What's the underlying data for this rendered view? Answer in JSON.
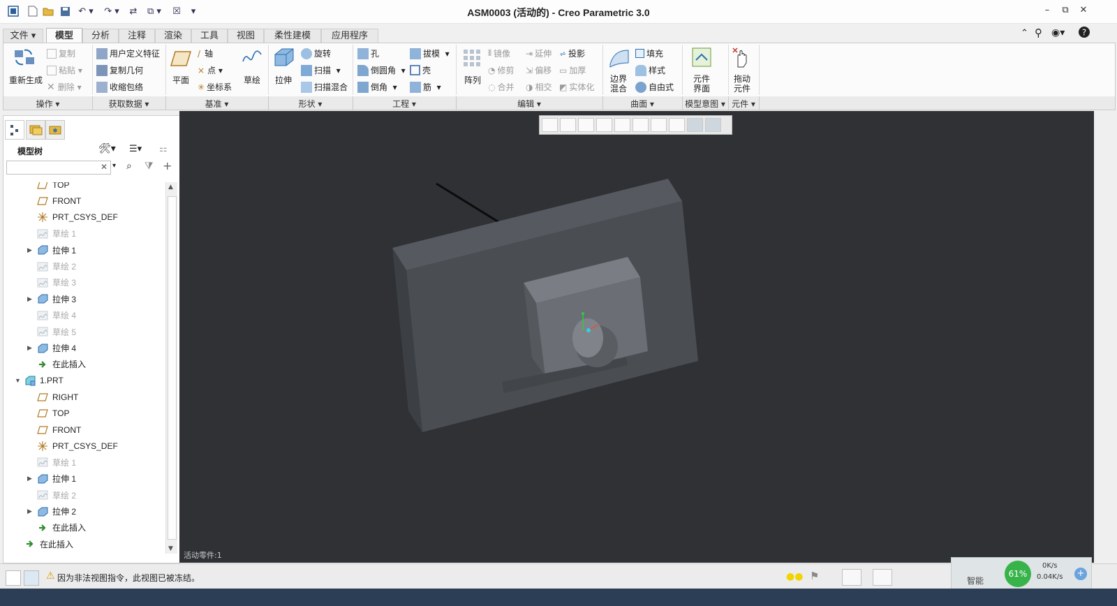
{
  "window": {
    "title": "ASM0003 (活动的) - Creo Parametric 3.0"
  },
  "tabs": [
    "文件",
    "模型",
    "分析",
    "注释",
    "渲染",
    "工具",
    "视图",
    "柔性建模",
    "应用程序"
  ],
  "ribbon": {
    "regenerate": "重新生成",
    "copy": "复制",
    "paste": "粘贴",
    "delete": "删除",
    "user_feature": "用户定义特征",
    "copy_geom": "复制几何",
    "shrinkwrap": "收缩包络",
    "plane": "平面",
    "axis": "轴",
    "point": "点",
    "csys": "坐标系",
    "sketch": "草绘",
    "extrude": "拉伸",
    "revolve": "旋转",
    "sweep": "扫描",
    "swept_blend": "扫描混合",
    "hole": "孔",
    "round": "倒圆角",
    "chamfer": "倒角",
    "draft": "拔模",
    "shell": "壳",
    "rib": "筋",
    "pattern": "阵列",
    "mirror": "镜像",
    "trim": "修剪",
    "merge": "合并",
    "extend": "延伸",
    "offset": "偏移",
    "intersect": "相交",
    "project": "投影",
    "thicken": "加厚",
    "solidify": "实体化",
    "boundary_blend_1": "边界",
    "boundary_blend_2": "混合",
    "fill": "填充",
    "style": "样式",
    "freestyle": "自由式",
    "comp_iface_1": "元件",
    "comp_iface_2": "界面",
    "drag_1": "拖动",
    "drag_2": "元件"
  },
  "groups": [
    "操作",
    "获取数据",
    "基准",
    "形状",
    "工程",
    "编辑",
    "曲面",
    "模型意图",
    "元件"
  ],
  "panel": {
    "title": "模型树"
  },
  "tree": [
    {
      "label": "TOP",
      "indent": 2,
      "icon": "plane",
      "dim": false,
      "expander": ""
    },
    {
      "label": "FRONT",
      "indent": 2,
      "icon": "plane",
      "dim": false,
      "expander": ""
    },
    {
      "label": "PRT_CSYS_DEF",
      "indent": 2,
      "icon": "csys",
      "dim": false,
      "expander": ""
    },
    {
      "label": "草绘 1",
      "indent": 2,
      "icon": "sketch",
      "dim": true,
      "expander": ""
    },
    {
      "label": "拉伸 1",
      "indent": 2,
      "icon": "extrude",
      "dim": false,
      "expander": "▶"
    },
    {
      "label": "草绘 2",
      "indent": 2,
      "icon": "sketch",
      "dim": true,
      "expander": ""
    },
    {
      "label": "草绘 3",
      "indent": 2,
      "icon": "sketch",
      "dim": true,
      "expander": ""
    },
    {
      "label": "拉伸 3",
      "indent": 2,
      "icon": "extrude",
      "dim": false,
      "expander": "▶"
    },
    {
      "label": "草绘 4",
      "indent": 2,
      "icon": "sketch",
      "dim": true,
      "expander": ""
    },
    {
      "label": "草绘 5",
      "indent": 2,
      "icon": "sketch",
      "dim": true,
      "expander": ""
    },
    {
      "label": "拉伸 4",
      "indent": 2,
      "icon": "extrude",
      "dim": false,
      "expander": "▶"
    },
    {
      "label": "在此插入",
      "indent": 2,
      "icon": "insert",
      "dim": false,
      "expander": ""
    },
    {
      "label": "1.PRT",
      "indent": 1,
      "icon": "part",
      "dim": false,
      "expander": "▼"
    },
    {
      "label": "RIGHT",
      "indent": 2,
      "icon": "plane",
      "dim": false,
      "expander": ""
    },
    {
      "label": "TOP",
      "indent": 2,
      "icon": "plane",
      "dim": false,
      "expander": ""
    },
    {
      "label": "FRONT",
      "indent": 2,
      "icon": "plane",
      "dim": false,
      "expander": ""
    },
    {
      "label": "PRT_CSYS_DEF",
      "indent": 2,
      "icon": "csys",
      "dim": false,
      "expander": ""
    },
    {
      "label": "草绘 1",
      "indent": 2,
      "icon": "sketch",
      "dim": true,
      "expander": ""
    },
    {
      "label": "拉伸 1",
      "indent": 2,
      "icon": "extrude",
      "dim": false,
      "expander": "▶"
    },
    {
      "label": "草绘 2",
      "indent": 2,
      "icon": "sketch",
      "dim": true,
      "expander": ""
    },
    {
      "label": "拉伸 2",
      "indent": 2,
      "icon": "extrude",
      "dim": false,
      "expander": "▶"
    },
    {
      "label": "在此插入",
      "indent": 2,
      "icon": "insert",
      "dim": false,
      "expander": ""
    },
    {
      "label": "在此插入",
      "indent": 1,
      "icon": "insert",
      "dim": false,
      "expander": ""
    }
  ],
  "viewport": {
    "active_part": "活动零件:1"
  },
  "status": {
    "message": "因为非法视图指令，此视图已被冻结。",
    "smart": "智能",
    "net_pct": "61%",
    "up_rate": "0K/s",
    "down_rate": "0.04K/s"
  }
}
